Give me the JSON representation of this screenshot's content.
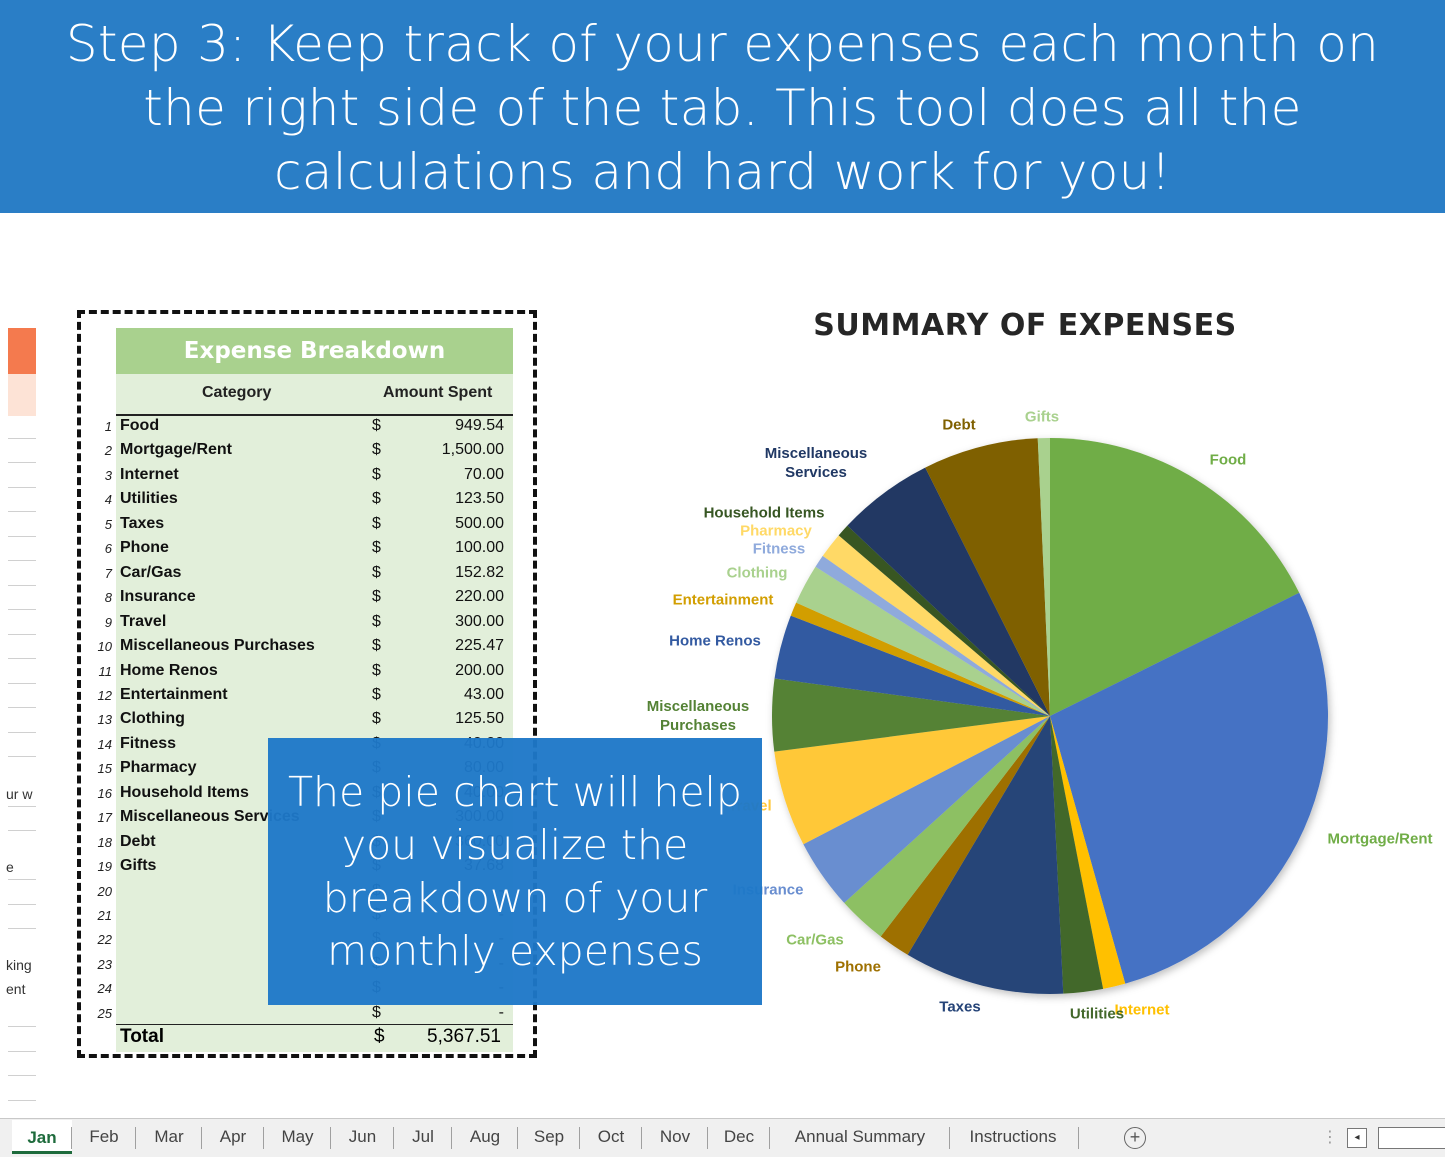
{
  "banner": {
    "lines": [
      "Step 3: Keep track of your expenses each month on",
      "the right side of the tab. This tool does all the",
      "calculations and hard work for you!"
    ]
  },
  "left_sheet": {
    "fragments": [
      "ur w",
      "e",
      "king",
      "ent"
    ]
  },
  "table": {
    "title": "Expense Breakdown",
    "headers": {
      "category": "Category",
      "amount": "Amount Spent"
    },
    "rows": [
      {
        "n": "1",
        "category": "Food",
        "dollar": "$",
        "amount": "949.54"
      },
      {
        "n": "2",
        "category": "Mortgage/Rent",
        "dollar": "$",
        "amount": "1,500.00"
      },
      {
        "n": "3",
        "category": "Internet",
        "dollar": "$",
        "amount": "70.00"
      },
      {
        "n": "4",
        "category": "Utilities",
        "dollar": "$",
        "amount": "123.50"
      },
      {
        "n": "5",
        "category": "Taxes",
        "dollar": "$",
        "amount": "500.00"
      },
      {
        "n": "6",
        "category": "Phone",
        "dollar": "$",
        "amount": "100.00"
      },
      {
        "n": "7",
        "category": "Car/Gas",
        "dollar": "$",
        "amount": "152.82"
      },
      {
        "n": "8",
        "category": "Insurance",
        "dollar": "$",
        "amount": "220.00"
      },
      {
        "n": "9",
        "category": "Travel",
        "dollar": "$",
        "amount": "300.00"
      },
      {
        "n": "10",
        "category": "Miscellaneous Purchases",
        "dollar": "$",
        "amount": "225.47"
      },
      {
        "n": "11",
        "category": "Home Renos",
        "dollar": "$",
        "amount": "200.00"
      },
      {
        "n": "12",
        "category": "Entertainment",
        "dollar": "$",
        "amount": "43.00"
      },
      {
        "n": "13",
        "category": "Clothing",
        "dollar": "$",
        "amount": "125.50"
      },
      {
        "n": "14",
        "category": "Fitness",
        "dollar": "$",
        "amount": "40.00"
      },
      {
        "n": "15",
        "category": "Pharmacy",
        "dollar": "$",
        "amount": "80.00"
      },
      {
        "n": "16",
        "category": "Household Items",
        "dollar": "$",
        "amount": "40.00"
      },
      {
        "n": "17",
        "category": "Miscellaneous Services",
        "dollar": "$",
        "amount": "300.00"
      },
      {
        "n": "18",
        "category": "Debt",
        "dollar": "$",
        "amount": "360.00"
      },
      {
        "n": "19",
        "category": "Gifts",
        "dollar": "$",
        "amount": "37.68"
      },
      {
        "n": "20",
        "category": "",
        "dollar": "$",
        "amount": "-"
      },
      {
        "n": "21",
        "category": "",
        "dollar": "$",
        "amount": "-"
      },
      {
        "n": "22",
        "category": "",
        "dollar": "$",
        "amount": "-"
      },
      {
        "n": "23",
        "category": "",
        "dollar": "$",
        "amount": "-"
      },
      {
        "n": "24",
        "category": "",
        "dollar": "$",
        "amount": "-"
      },
      {
        "n": "25",
        "category": "",
        "dollar": "$",
        "amount": "-"
      }
    ],
    "total": {
      "label": "Total",
      "dollar": "$",
      "amount": "5,367.51"
    }
  },
  "callout": {
    "lines": [
      "The pie chart will help",
      "you visualize the",
      "breakdown of your",
      "monthly expenses"
    ]
  },
  "chart_data": {
    "type": "pie",
    "title": "SUMMARY OF EXPENSES",
    "start": "12 o'clock, clockwise",
    "labels": [
      "Food",
      "Mortgage/Rent",
      "Internet",
      "Utilities",
      "Taxes",
      "Phone",
      "Car/Gas",
      "Insurance",
      "Travel",
      "Miscellaneous Purchases",
      "Home Renos",
      "Entertainment",
      "Clothing",
      "Fitness",
      "Pharmacy",
      "Household Items",
      "Miscellaneous Services",
      "Debt",
      "Gifts"
    ],
    "values": [
      949.54,
      1500.0,
      70.0,
      123.5,
      500.0,
      100.0,
      152.82,
      220.0,
      300.0,
      225.47,
      200.0,
      43.0,
      125.5,
      40.0,
      80.0,
      40.0,
      300.0,
      360.0,
      37.68
    ],
    "colors": [
      "#70ad47",
      "#4472c4",
      "#ffc000",
      "#43682b",
      "#264478",
      "#9e7000",
      "#8dc063",
      "#698ed0",
      "#ffc839",
      "#548235",
      "#335aa1",
      "#d29e00",
      "#a9d18e",
      "#8faadc",
      "#ffd966",
      "#375623",
      "#203864",
      "#7f6000",
      "#a9d18e"
    ],
    "label_colors": [
      "#70ad47",
      "#70ad47",
      "#ffc000",
      "#43682b",
      "#264478",
      "#9e7000",
      "#8dc063",
      "#698ed0",
      "#ffc839",
      "#548235",
      "#335aa1",
      "#d29e00",
      "#a9d18e",
      "#8faadc",
      "#ffd966",
      "#375623",
      "#203864",
      "#7f6000",
      "#a9d18e"
    ],
    "legend": "none (data labels outside)"
  },
  "tabs": {
    "items": [
      "Jan",
      "Feb",
      "Mar",
      "Apr",
      "May",
      "Jun",
      "Jul",
      "Aug",
      "Sep",
      "Oct",
      "Nov",
      "Dec",
      "Annual Summary",
      "Instructions"
    ],
    "active": "Jan",
    "add_symbol": "+",
    "more_symbol": "⋮",
    "scroll_left_symbol": "◂"
  }
}
